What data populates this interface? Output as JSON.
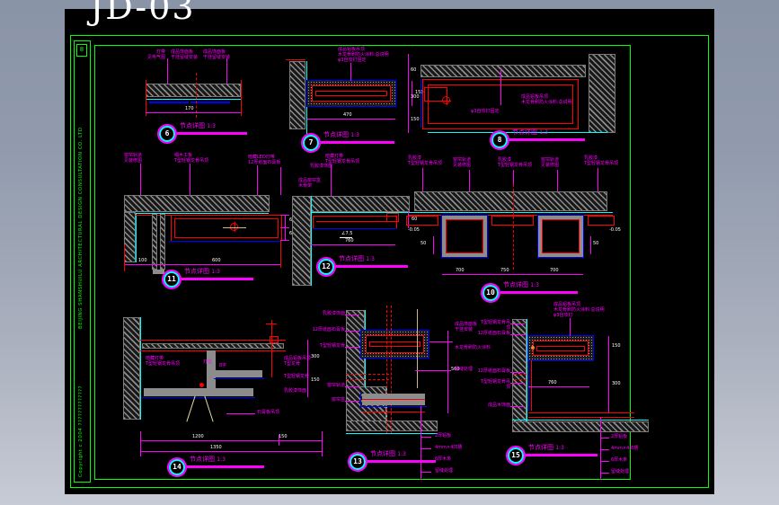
{
  "colors": {
    "background_gray": "#9aa4b5",
    "canvas": "#000000",
    "frame_green": "#00ff00",
    "annotation_magenta": "#ff00ff",
    "hatch_gray": "#8c8c8c",
    "line_red": "#ff0000",
    "line_cyan": "#00ffff",
    "line_blue": "#0000ff",
    "dim_white": "#ffffff",
    "lamp_yellow": "#e6e0a0"
  },
  "sheet": {
    "code": "JD-03",
    "company": "BEIJING SHANSHUILU ARCHITECTURAL DESIGN CONSULTATION CO. LTD",
    "copyright": "Copyright  c  2004  ?????????????",
    "logo_mark": "8"
  },
  "details": [
    {
      "number": "6",
      "title": "节点详图",
      "scale": "1:3",
      "labels": [
        "灯带\n见电气图",
        "成品饰面板\n干挂留缝安装",
        "成品饰面板\n干挂留缝安装"
      ],
      "dims": [
        "170"
      ]
    },
    {
      "number": "7",
      "title": "节点详图",
      "scale": "1:3",
      "labels": [
        "成品铝板吊顶\n木龙骨刷防火涂料:总说明\nφ3自攻钉固定"
      ],
      "dims": [
        "470",
        "150"
      ]
    },
    {
      "number": "8",
      "title": "节点详图",
      "scale": "1:3",
      "labels": [
        "成品铝板吊顶\n木龙骨刷防火涂料:总说明",
        "φ3自攻钉固定"
      ],
      "dims": [
        "60",
        "300",
        "150"
      ]
    },
    {
      "number": "11",
      "title": "节点详图",
      "scale": "1:3",
      "labels": [
        "窗帘轨道\n见装修图",
        "细木工板\nT型轻钢龙骨吊顶",
        "暗藏LED灯带\n12厚纸面石膏板",
        "成品窗帘盒\n木骨架",
        "乳胶漆饰面"
      ],
      "dims": [
        "100",
        "600",
        "60",
        "60"
      ]
    },
    {
      "number": "12",
      "title": "节点详图",
      "scale": "1:3",
      "labels": [
        "暗藏灯带\nT型轻钢龙骨吊顶"
      ],
      "dims": [
        "760",
        "60",
        "∠7.5"
      ]
    },
    {
      "number": "10",
      "title": "节点详图",
      "scale": "1:3",
      "labels": [
        "乳胶漆\nT型轻钢龙骨吊顶",
        "窗帘轨道\n见装修图",
        "乳胶漆\nT型轻钢龙骨吊顶",
        "窗帘轨道\n见装修图",
        "乳胶漆\nT型轻钢龙骨吊顶"
      ],
      "dims": [
        "700",
        "750",
        "700",
        "50",
        "50",
        "-0.05",
        "-0.05"
      ]
    },
    {
      "number": "14",
      "title": "节点详图",
      "scale": "1:3",
      "labels": [
        "暗藏灯带\nT型轻钢龙骨吊顶",
        "灯位",
        "8字",
        "成品铝板吊顶\nT型龙骨",
        "T型轻钢龙骨",
        "乳胶漆饰面",
        "石膏板吊顶"
      ],
      "dims": [
        "300",
        "150",
        "1200",
        "150",
        "1350"
      ]
    },
    {
      "number": "13",
      "title": "节点详图",
      "scale": "1:3",
      "labels": [
        "乳胶漆饰面",
        "12厚纸面石膏板",
        "T型轻钢龙骨",
        "窗帘轨道",
        "窗帘盒",
        "成品饰面板\n干挂安装",
        "木龙骨刷防火涂料",
        "留缝处理",
        "2厚铝板",
        "4mm×4凹槽",
        "6厚木条",
        "留缝处理"
      ],
      "dims": [
        "560"
      ]
    },
    {
      "number": "15",
      "title": "节点详图",
      "scale": "1:3",
      "labels": [
        "成品铝板吊顶\n木龙骨刷防火涂料:总说明\nφ3自攻钉",
        "T型轻钢龙骨吊顶",
        "12厚纸面石膏板",
        "12厚纸面石膏板",
        "T型轻钢龙骨吊顶",
        "成品木饰面",
        "2厚铝板",
        "4mm×4凹槽",
        "6厚木条",
        "留缝处理"
      ],
      "dims": [
        "150",
        "300",
        "760"
      ]
    }
  ]
}
